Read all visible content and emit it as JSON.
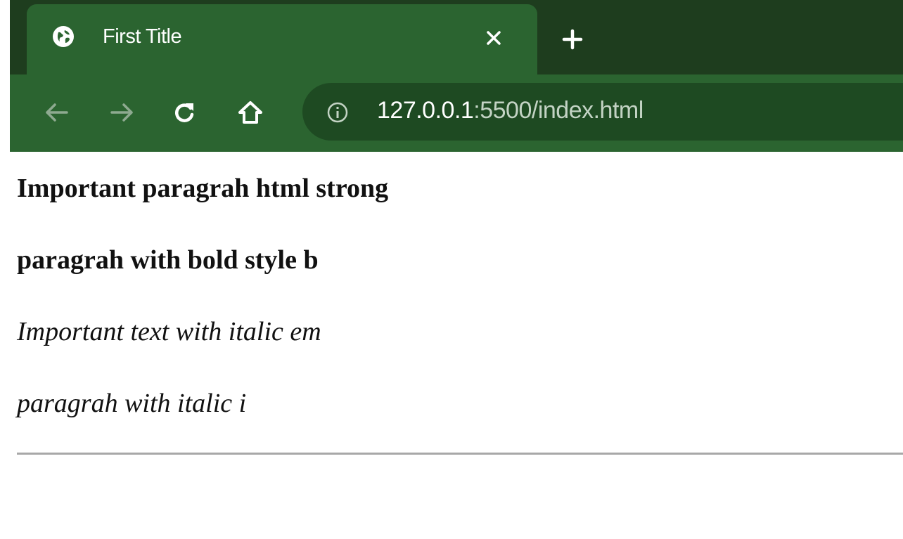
{
  "tab": {
    "title": "First Title",
    "favicon": "globe-icon",
    "close": "close-icon"
  },
  "toolbar": {
    "back": "arrow-left-icon",
    "forward": "arrow-right-icon",
    "reload": "reload-icon",
    "home": "home-icon",
    "new_tab": "plus-icon"
  },
  "address": {
    "info_icon": "info-icon",
    "host": "127.0.0.1",
    "rest": ":5500/index.html"
  },
  "page": {
    "strong_text": "Important paragrah html strong",
    "bold_text": "paragrah with bold style b",
    "em_text": "Important text with italic em",
    "italic_text": "paragrah with italic i"
  },
  "colors": {
    "tabstrip": "#1e3d1e",
    "toolbar": "#2b6430",
    "omnibox": "#1e4a22"
  }
}
